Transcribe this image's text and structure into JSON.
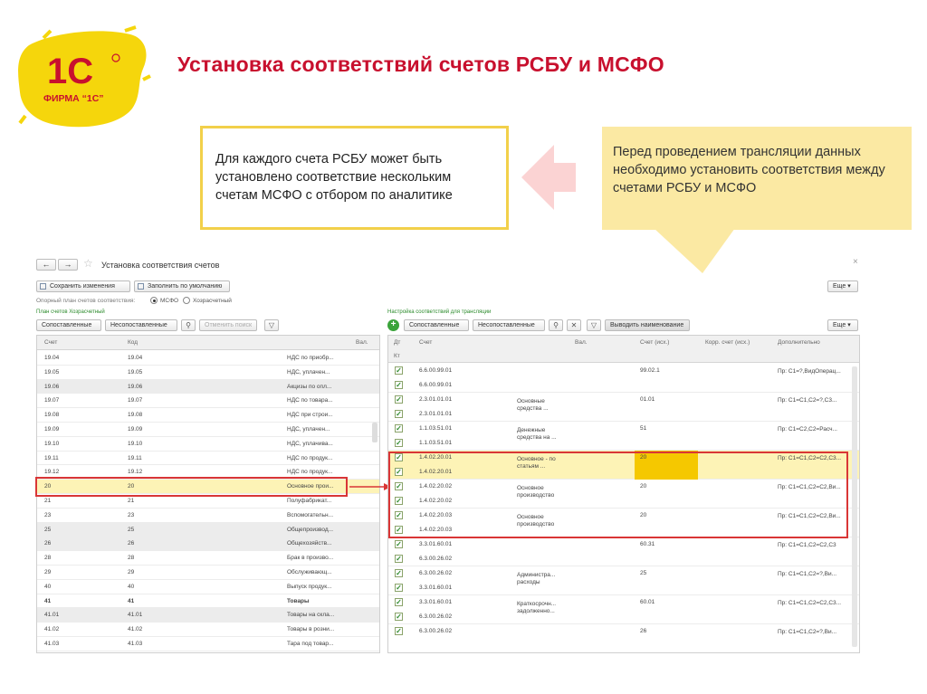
{
  "slide": {
    "title": "Установка соответствий счетов РСБУ и МСФО",
    "logo_mark": "1С",
    "logo_text": "ФИРМА “1С”",
    "callout_left": "Для каждого счета РСБУ может быть установлено соответствие нескольким счетам МСФО с отбором по аналитике",
    "callout_right": "Перед проведением трансляции данных необходимо установить соответствия между счетами РСБУ и МСФО"
  },
  "colors": {
    "title": "#c8102e",
    "callout_border": "#f2d04a",
    "callout_fill": "#fbe9a3",
    "highlight": "#fdf3b6",
    "red_frame": "#d93636"
  },
  "window": {
    "nav_back": "←",
    "nav_fwd": "→",
    "star": "☆",
    "title": "Установка соответствия счетов",
    "close": "×",
    "save_btn": "Сохранить изменения",
    "fill_default_btn": "Заполнить по умолчанию",
    "more_btn": "Еще ▾",
    "ref_plan_label": "Опорный план счетов соответствия:",
    "radio_ifrs": "МСФО",
    "radio_local": "Хозрасчетный"
  },
  "left_panel": {
    "section_title": "План счетов Хозрасчетный",
    "btn_matched": "Сопоставленные",
    "btn_unmatched": "Несопоставленные",
    "search_icon": "magnifier-icon",
    "cancel_search": "Отменить поиск",
    "filter_icon": "funnel-icon",
    "columns": [
      "Счет",
      "Код",
      "",
      "Вал."
    ],
    "rows": [
      {
        "account": "19.04",
        "code": "19.04",
        "name": "НДС по приобр...",
        "shade": false,
        "bold": false
      },
      {
        "account": "19.05",
        "code": "19.05",
        "name": "НДС, уплачен...",
        "shade": false,
        "bold": false
      },
      {
        "account": "19.06",
        "code": "19.06",
        "name": "Акцизы по опл...",
        "shade": true,
        "bold": false
      },
      {
        "account": "19.07",
        "code": "19.07",
        "name": "НДС по товара...",
        "shade": false,
        "bold": false
      },
      {
        "account": "19.08",
        "code": "19.08",
        "name": "НДС при строи...",
        "shade": false,
        "bold": false
      },
      {
        "account": "19.09",
        "code": "19.09",
        "name": "НДС, уплачен...",
        "shade": false,
        "bold": false
      },
      {
        "account": "19.10",
        "code": "19.10",
        "name": "НДС, уплачива...",
        "shade": false,
        "bold": false
      },
      {
        "account": "19.11",
        "code": "19.11",
        "name": "НДС по продук...",
        "shade": false,
        "bold": false
      },
      {
        "account": "19.12",
        "code": "19.12",
        "name": "НДС по продук...",
        "shade": false,
        "bold": false
      },
      {
        "account": "20",
        "code": "20",
        "name": "Основное прои...",
        "shade": false,
        "bold": false,
        "selected": true
      },
      {
        "account": "21",
        "code": "21",
        "name": "Полуфабрикат...",
        "shade": false,
        "bold": false
      },
      {
        "account": "23",
        "code": "23",
        "name": "Вспомогательн...",
        "shade": false,
        "bold": false
      },
      {
        "account": "25",
        "code": "25",
        "name": "Общепроизвод...",
        "shade": true,
        "bold": false
      },
      {
        "account": "26",
        "code": "26",
        "name": "Общехозяйств...",
        "shade": true,
        "bold": false
      },
      {
        "account": "28",
        "code": "28",
        "name": "Брак в произво...",
        "shade": false,
        "bold": false
      },
      {
        "account": "29",
        "code": "29",
        "name": "Обслуживающ...",
        "shade": false,
        "bold": false
      },
      {
        "account": "40",
        "code": "40",
        "name": "Выпуск продук...",
        "shade": false,
        "bold": false
      },
      {
        "account": "41",
        "code": "41",
        "name": "Товары",
        "shade": false,
        "bold": true
      },
      {
        "account": "41.01",
        "code": "41.01",
        "name": "Товары на скла...",
        "shade": true,
        "bold": false
      },
      {
        "account": "41.02",
        "code": "41.02",
        "name": "Товары в розни...",
        "shade": false,
        "bold": false
      },
      {
        "account": "41.03",
        "code": "41.03",
        "name": "Тара под товар...",
        "shade": false,
        "bold": false
      }
    ]
  },
  "right_panel": {
    "section_title": "Настройка соответствий для трансляции",
    "add_icon": "plus-icon",
    "btn_matched": "Сопоставленные",
    "btn_unmatched": "Несопоставленные",
    "btn_show_names": "Выводить наименование",
    "more_btn": "Еще ▾",
    "columns": {
      "dt": "Дт",
      "kt": "Кт",
      "account": "Счет",
      "cur": "Вал.",
      "acc_src": "Счет (исх.)",
      "corr": "Корр. счет (исх.)",
      "extra": "Дополнительно"
    },
    "groups": [
      {
        "dt": "6.6.00.99.01",
        "kt": "6.6.00.99.01",
        "name": "",
        "src": "99.02.1",
        "extra": "Пр: С1=?,ВидОперац..."
      },
      {
        "dt": "2.3.01.01.01",
        "kt": "2.3.01.01.01",
        "name": "Основные средства ...",
        "src": "01.01",
        "extra": "Пр: С1=С1,С2=?,С3..."
      },
      {
        "dt": "1.1.03.51.01",
        "kt": "1.1.03.51.01",
        "name": "Денежные средства на ...",
        "src": "51",
        "extra": "Пр: С1=С2,С2=Расч..."
      },
      {
        "dt": "1.4.02.20.01",
        "kt": "1.4.02.20.01",
        "name": "Основное - по статьям ...",
        "src": "20",
        "extra": "Пр: С1=С1,С2=С2,С3...",
        "highlight": true
      },
      {
        "dt": "1.4.02.20.02",
        "kt": "1.4.02.20.02",
        "name": "Основное производство",
        "src": "20",
        "extra": "Пр: С1=С1,С2=С2,Ви..."
      },
      {
        "dt": "1.4.02.20.03",
        "kt": "1.4.02.20.03",
        "name": "Основное производство",
        "src": "20",
        "extra": "Пр: С1=С1,С2=С2,Ви..."
      },
      {
        "dt": "3.3.01.60.01",
        "kt": "6.3.00.26.02",
        "name": "",
        "src": "60.31",
        "extra": "Пр: С1=С1,С2=С2,С3"
      },
      {
        "dt": "6.3.00.26.02",
        "kt": "3.3.01.60.01",
        "name": "Администра... расходы",
        "src": "25",
        "extra": "Пр: С1=С1,С2=?,Ви..."
      },
      {
        "dt": "3.3.01.60.01",
        "kt": "6.3.00.26.02",
        "name": "Краткосрочн... задолженно...",
        "src": "60.01",
        "extra": "Пр: С1=С1,С2=С2,С3..."
      },
      {
        "dt": "6.3.00.26.02",
        "kt": "",
        "name": "",
        "src": "26",
        "extra": "Пр: С1=С1,С2=?,Ви..."
      }
    ]
  }
}
